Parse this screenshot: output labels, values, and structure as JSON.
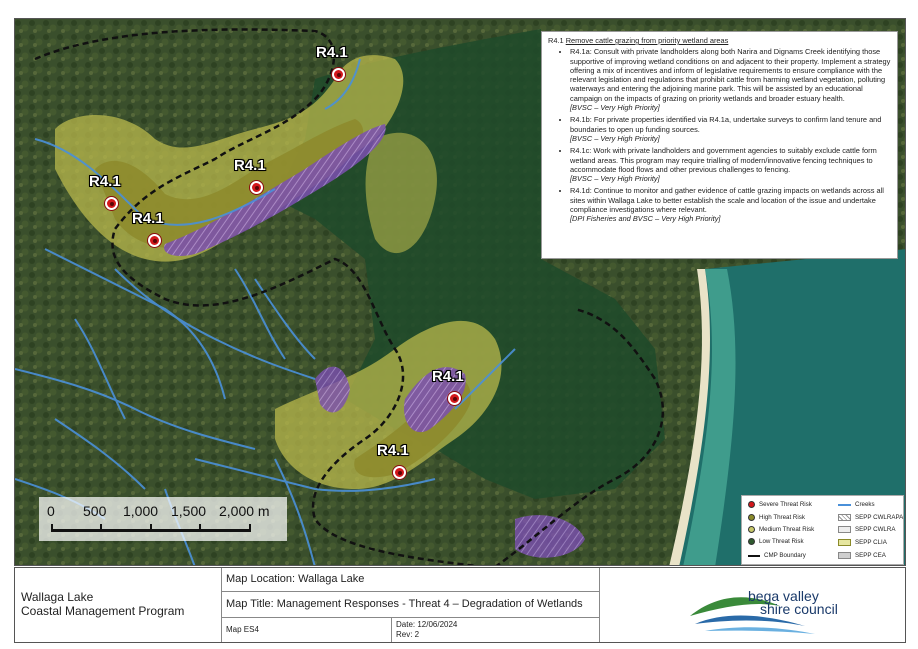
{
  "textbox": {
    "heading_code": "R4.1",
    "heading_title": "Remove cattle grazing from priority wetland areas",
    "items": [
      {
        "text": "R4.1a: Consult with private landholders along both Narira and Dignams Creek identifying those supportive of improving wetland conditions on and adjacent to their property. Implement a strategy offering a mix of incentives and inform of legislative requirements to ensure compliance with the relevant legislation and regulations that prohibit cattle from harming wetland vegetation, polluting waterways and entering the adjoining marine park. This will be assisted by an educational campaign on the impacts of grazing on priority wetlands and broader estuary health.",
        "source": "[BVSC – Very High Priority]"
      },
      {
        "text": "R4.1b: For private properties identified via R4.1a, undertake surveys to confirm land tenure and boundaries to open up funding sources.",
        "source": "[BVSC – Very High Priority]"
      },
      {
        "text": "R4.1c: Work with private landholders and government agencies to suitably exclude cattle form wetland areas. This program may require trialling of modern/innovative fencing techniques to accommodate flood flows and other previous challenges to fencing.",
        "source": "[BVSC – Very High Priority]"
      },
      {
        "text": "R4.1d: Continue to monitor and gather evidence of cattle grazing impacts on wetlands across all sites within Wallaga Lake to better establish the scale and location of the issue and undertake compliance investigations where relevant.",
        "source": "[DPI Fisheries and BVSC – Very High Priority]"
      }
    ]
  },
  "markers": [
    "R4.1",
    "R4.1",
    "R4.1",
    "R4.1",
    "R4.1",
    "R4.1"
  ],
  "scalebar": {
    "labels": [
      "0",
      "500",
      "1,000",
      "1,500",
      "2,000 m"
    ]
  },
  "legend": {
    "severe": "Severe Threat Risk",
    "high": "High Threat Risk",
    "medium": "Medium Threat Risk",
    "low": "Low Threat Risk",
    "cmp": "CMP Boundary",
    "creeks": "Creeks",
    "cwlrapa": "SEPP CWLRAPA",
    "cwlra": "SEPP CWLRA",
    "clia": "SEPP CLIA",
    "cea": "SEPP CEA",
    "colors": {
      "severe": "#d3171b",
      "high": "#8a8a2a",
      "medium": "#c8c86a",
      "low": "#2f5a2f",
      "creeks": "#4a90d9",
      "clia": "#e6e6a0",
      "cea": "#cfcfcf"
    }
  },
  "footer": {
    "program_line1": "Wallaga Lake",
    "program_line2": "Coastal Management Program",
    "location": "Map Location: Wallaga Lake",
    "title": "Map Title: Management Responses - Threat 4 – Degradation of Wetlands",
    "map_id": "Map ES4",
    "date": "Date: 12/06/2024",
    "rev": "Rev: 2",
    "logo_line1": "bega valley",
    "logo_line2": "shire council"
  }
}
